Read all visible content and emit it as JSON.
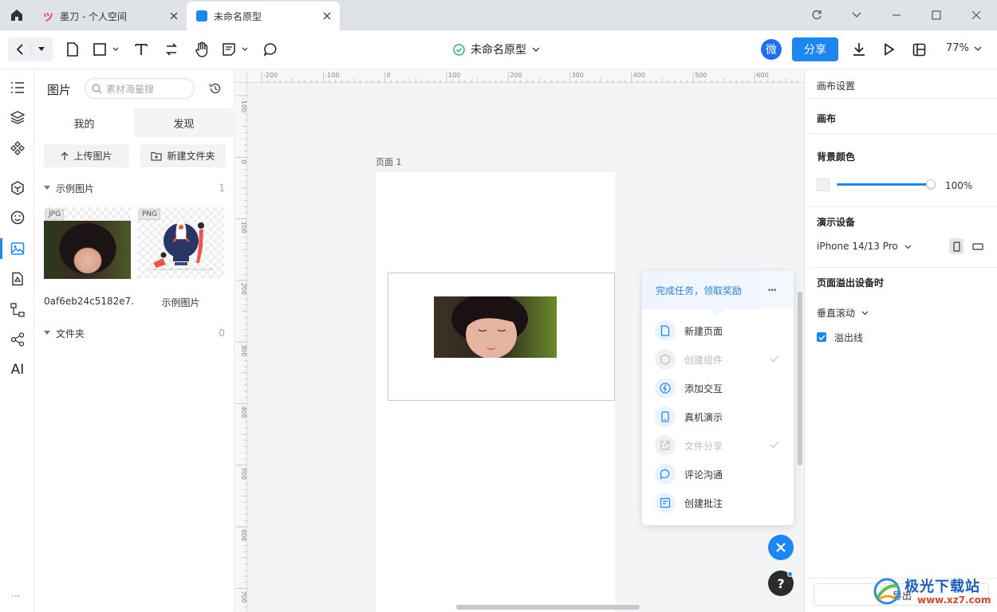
{
  "tabs": [
    {
      "label": "墨刀 - 个人空间",
      "active": false
    },
    {
      "label": "未命名原型",
      "active": true
    }
  ],
  "toolbar": {
    "doc_title": "未命名原型",
    "wei_label": "微",
    "share_label": "分享",
    "zoom": "77%"
  },
  "panel": {
    "title": "图片",
    "search_placeholder": "素材海量搜",
    "tabs": [
      "我的",
      "发现"
    ],
    "upload_label": "上传图片",
    "new_folder_label": "新建文件夹",
    "sample_group": {
      "label": "示例图片",
      "count": "1"
    },
    "images": [
      {
        "type": "JPG",
        "name": "0af6eb24c5182e7..."
      },
      {
        "type": "PNG",
        "name": "示例图片"
      }
    ],
    "folder_group": {
      "label": "文件夹",
      "count": "0"
    }
  },
  "canvas": {
    "page_label": "页面 1",
    "h_ticks": [
      "-200",
      "-100",
      "0",
      "100",
      "200",
      "300",
      "400",
      "500",
      "600"
    ],
    "v_ticks": [
      "-100",
      "0",
      "100",
      "200",
      "300",
      "400",
      "500",
      "600",
      "700"
    ]
  },
  "task_popup": {
    "title": "完成任务，领取奖励",
    "more": "···",
    "items": [
      {
        "label": "新建页面",
        "done": false,
        "icon": "file-icon"
      },
      {
        "label": "创建组件",
        "done": true,
        "icon": "component-icon"
      },
      {
        "label": "添加交互",
        "done": false,
        "icon": "lightning-icon"
      },
      {
        "label": "真机演示",
        "done": false,
        "icon": "phone-icon"
      },
      {
        "label": "文件分享",
        "done": true,
        "icon": "share-icon"
      },
      {
        "label": "评论沟通",
        "done": false,
        "icon": "comment-icon"
      },
      {
        "label": "创建批注",
        "done": false,
        "icon": "note-icon"
      }
    ]
  },
  "help_label": "?",
  "right_panel": {
    "header": "画布设置",
    "canvas_section": "画布",
    "bg_color_label": "背景颜色",
    "bg_opacity": "100%",
    "device_label": "演示设备",
    "device_value": "iPhone 14/13 Pro",
    "overflow_label": "页面溢出设备时",
    "scroll_value": "垂直滚动",
    "overflow_line_label": "溢出线",
    "export_label": "导出"
  },
  "rail_more": "...",
  "rail_ai": "AI",
  "watermark": {
    "name": "极光下载站",
    "url": "www.xz7.com"
  },
  "colors": {
    "accent": "#1e86f0",
    "success": "#2fb36a"
  }
}
